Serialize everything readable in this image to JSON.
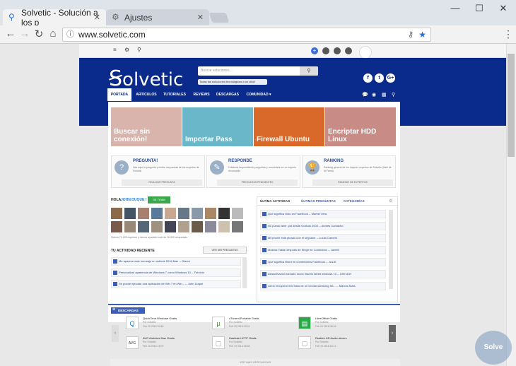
{
  "browser": {
    "tabs": [
      {
        "title": "Solvetic - Solución a los p",
        "icon": "solvetic-tab-icon"
      },
      {
        "title": "Ajustes",
        "icon": "gear-icon"
      }
    ],
    "url": "www.solvetic.com"
  },
  "site": {
    "brand": "olvetic",
    "search_placeholder": "Buscar soluciones...",
    "search_filter": "Todas las soluciones tecnológicas a un click!",
    "nav": [
      "PORTADA",
      "ARTICULOS",
      "TUTORIALES",
      "REVIEWS",
      "DESCARGAS",
      "COMUNIDAD ▾"
    ],
    "social": [
      "f",
      "t",
      "G+"
    ],
    "tiles": [
      {
        "label": "Buscar sin conexión!",
        "color": "#cfa9a3"
      },
      {
        "label": "Importar Pass",
        "color": "#6ab7c9"
      },
      {
        "label": "Firewall Ubuntu",
        "color": "#d8692a"
      },
      {
        "label": "Encriptar HDD Linux",
        "color": "#c98b86"
      }
    ],
    "cards": [
      {
        "title": "PREGUNTA!",
        "desc": "Haz aquí tu pregunta y recibe respuestas de los expertos de Solvetic",
        "button": "REALIZAR PREGUNTA",
        "icon": "?"
      },
      {
        "title": "RESPONDE",
        "desc": "Colabora respondiendo preguntas y conviértete en un experto reconocido",
        "button": "PREGUNTAS PENDIENTES",
        "icon": "✎"
      },
      {
        "title": "RANKING",
        "desc": "Ranking general de los mejores expertos de Solvetic (Salé de la Fama)",
        "button": "RANKING DE EXPERTOS",
        "icon": "🏆"
      }
    ],
    "greeting": "HOLA",
    "username": "JOHN DUQUE !",
    "team_btn": "SE TEAM",
    "avatars_text": "Somos 71.905 expertos y hemos ayudado todo de 10.000 respuestas",
    "activity_title": "TU ACTIVIDAD RECIENTE",
    "activity_btn": "VER MIS PREGUNTAS",
    "activity": [
      "Me aparece este mensaje en outlook 2016 Mac -- Gianni",
      "Personalizar apariencia de Windows 7 como Windows 10 -- Fabricio",
      "Se puede ejecutar una aplicación de Win 7 en Win... -- John Duque"
    ],
    "tabs_right": [
      "ÚLTIMA ACTIVIDAD",
      "ÚLTIMAS PREGUNTAS",
      "CATEGORÍAS"
    ],
    "latest": [
      "Qué significa visto en Facebook -- Marbel Vera",
      "No puedo abrir .pst desde Outlook 2003 -- Andrés Camacho",
      "Mi iphone está pinado con el seguidor -- Lucas Camero",
      "Mostrar Tabla Después de Elegir en Combobox -- Janet0",
      "Qué significa Word en comentarios Facebook -- JULIE",
      "Desactivación tarnado modo tiradrio tablet windows 10 -- LiteroDel",
      "cómo recuperar mis fotos de un celular samsung S5... -- Marcos Mats"
    ],
    "downloads_title": "DESCARGAS",
    "downloads": [
      {
        "name": "QuickTime Windows Gratis",
        "by": "Por Solvetic",
        "date": "Feb 20 2016 09:48",
        "icon": "Q",
        "color": "#1a7ad8"
      },
      {
        "name": "uTorrent Portable Gratis",
        "by": "Por Solvetic",
        "date": "Feb 20 2016 09:31",
        "icon": "µ",
        "color": "#3a9c2a"
      },
      {
        "name": "LibreOffice Gratis",
        "by": "Por Solvetic",
        "date": "Feb 20 2016 08:18",
        "icon": "▤",
        "color": "#2aa84a"
      },
      {
        "name": "AVG Antivirus Mac Gratis",
        "by": "Por Solvetic",
        "date": "Feb 19 2016 16:09",
        "icon": "AVG",
        "color": "#333"
      },
      {
        "name": "Hashtab HCTP Gratis",
        "by": "Por Solvetic",
        "date": "Feb 19 2016 18:38",
        "icon": "▢",
        "color": "#999"
      },
      {
        "name": "Realtek HD Audio drivers",
        "by": "Por Solvetic",
        "date": "Feb 19 2016 15:13",
        "icon": "▢",
        "color": "#999"
      }
    ],
    "see_more": "VER MAS DESCARGAS"
  },
  "watermark": "Solve"
}
